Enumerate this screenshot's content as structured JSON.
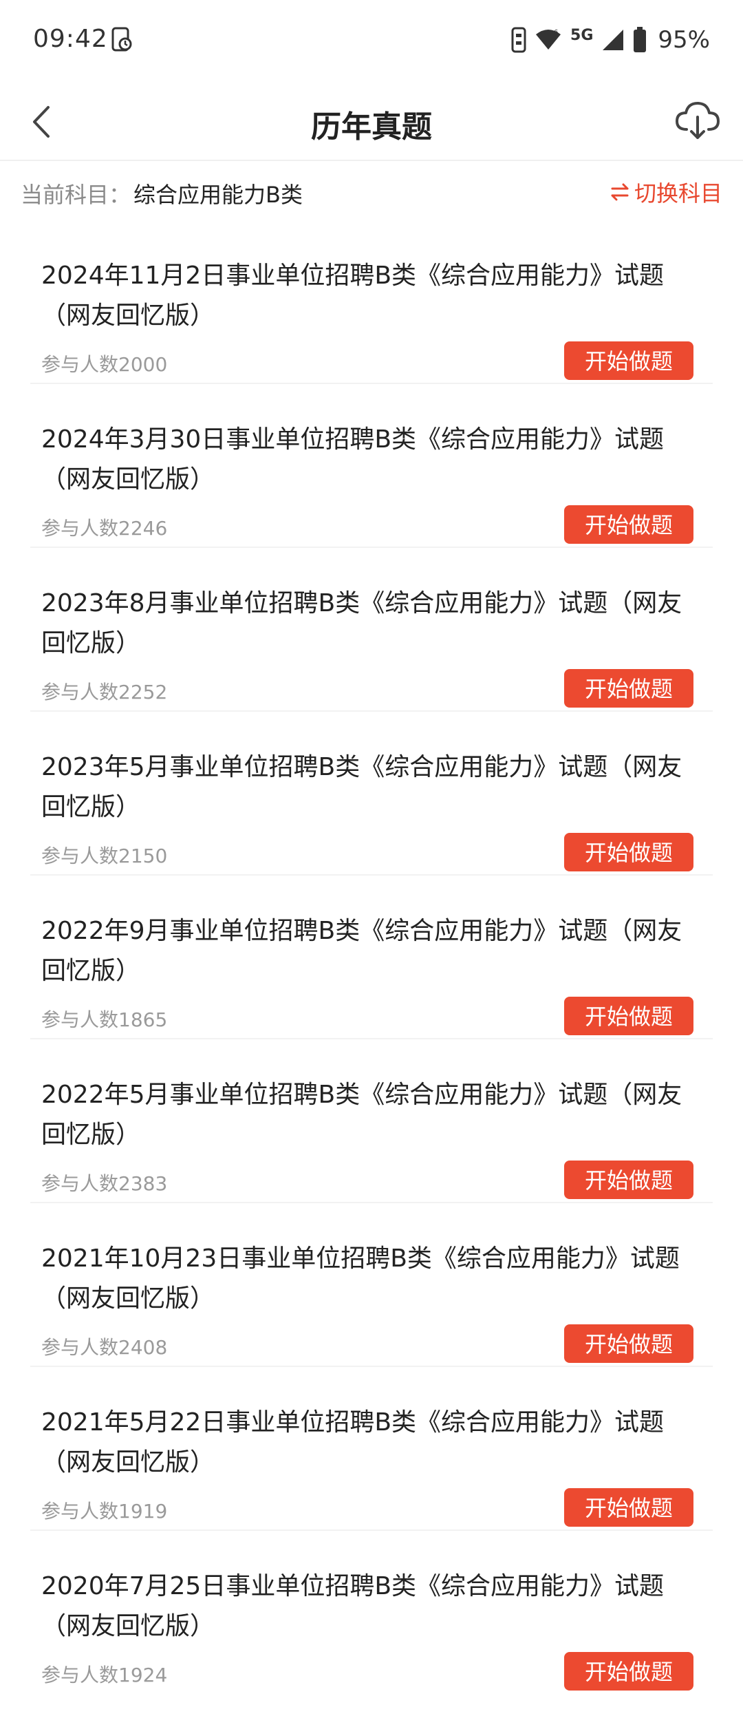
{
  "status_bar": {
    "time": "09:42",
    "signal_label": "5G",
    "battery": "95%"
  },
  "header": {
    "title": "历年真题"
  },
  "subject": {
    "label": "当前科目：",
    "value": "综合应用能力B类",
    "switch_label": "切换科目"
  },
  "exams": [
    {
      "title": "2024年11月2日事业单位招聘B类《综合应用能力》试题（网友回忆版）",
      "count": "参与人数2000",
      "button": "开始做题"
    },
    {
      "title": "2024年3月30日事业单位招聘B类《综合应用能力》试题（网友回忆版）",
      "count": "参与人数2246",
      "button": "开始做题"
    },
    {
      "title": "2023年8月事业单位招聘B类《综合应用能力》试题（网友回忆版）",
      "count": "参与人数2252",
      "button": "开始做题"
    },
    {
      "title": "2023年5月事业单位招聘B类《综合应用能力》试题（网友回忆版）",
      "count": "参与人数2150",
      "button": "开始做题"
    },
    {
      "title": "2022年9月事业单位招聘B类《综合应用能力》试题（网友回忆版）",
      "count": "参与人数1865",
      "button": "开始做题"
    },
    {
      "title": "2022年5月事业单位招聘B类《综合应用能力》试题（网友回忆版）",
      "count": "参与人数2383",
      "button": "开始做题"
    },
    {
      "title": "2021年10月23日事业单位招聘B类《综合应用能力》试题（网友回忆版）",
      "count": "参与人数2408",
      "button": "开始做题"
    },
    {
      "title": "2021年5月22日事业单位招聘B类《综合应用能力》试题（网友回忆版）",
      "count": "参与人数1919",
      "button": "开始做题"
    },
    {
      "title": "2020年7月25日事业单位招聘B类《综合应用能力》试题（网友回忆版）",
      "count": "参与人数1924",
      "button": "开始做题"
    }
  ],
  "colors": {
    "accent": "#ec4a30",
    "muted_text": "#9a9a9a"
  }
}
